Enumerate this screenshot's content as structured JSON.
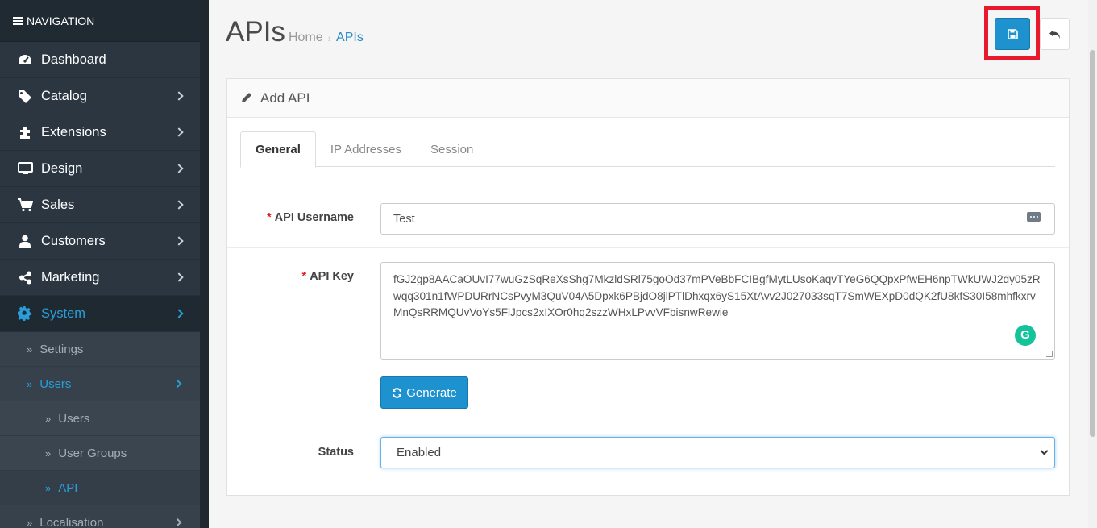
{
  "sidebar": {
    "header": "NAVIGATION",
    "items": [
      {
        "label": "Dashboard",
        "icon": "dashboard-icon"
      },
      {
        "label": "Catalog",
        "icon": "tags-icon"
      },
      {
        "label": "Extensions",
        "icon": "puzzle-icon"
      },
      {
        "label": "Design",
        "icon": "desktop-icon"
      },
      {
        "label": "Sales",
        "icon": "cart-icon"
      },
      {
        "label": "Customers",
        "icon": "user-icon"
      },
      {
        "label": "Marketing",
        "icon": "share-icon"
      },
      {
        "label": "System",
        "icon": "gear-icon"
      }
    ],
    "system_sub": {
      "settings": "Settings",
      "users": "Users",
      "users_sub": [
        "Users",
        "User Groups",
        "API"
      ],
      "localisation": "Localisation"
    }
  },
  "header": {
    "title": "APIs",
    "breadcrumb": [
      "Home",
      "APIs"
    ],
    "breadcrumb_sep": "›"
  },
  "panel": {
    "heading": "Add API",
    "tabs": [
      "General",
      "IP Addresses",
      "Session"
    ],
    "fields": {
      "username_label": "API Username",
      "username_value": "Test",
      "apikey_label": "API Key",
      "apikey_value": "fGJ2gp8AACaOUvI77wuGzSqReXsShg7MkzldSRl75goOd37mPVeBbFCIBgfMytLUsoKaqvTYeG6QQpxPfwEH6npTWkUWJ2dy05zRwqq301n1fWPDURrNCsPvyM3QuV04A5Dpxk6PBjdO8jlPTlDhxqx6yS15XtAvv2J027033sqT7SmWEXpD0dQK2fU8kfS30I58mhfkxrvMnQsRRMQUvVoYs5FlJpcs2xIXOr0hq2szzWHxLPvvVFbisnwRewie",
      "generate_label": "Generate",
      "status_label": "Status",
      "status_value": "Enabled",
      "required_mark": "*"
    }
  },
  "colors": {
    "primary": "#1e91cf",
    "sidebar_bg": "#2b3641",
    "active_link": "#2a9ed8",
    "highlight": "#e8192c",
    "required": "#e02020"
  }
}
